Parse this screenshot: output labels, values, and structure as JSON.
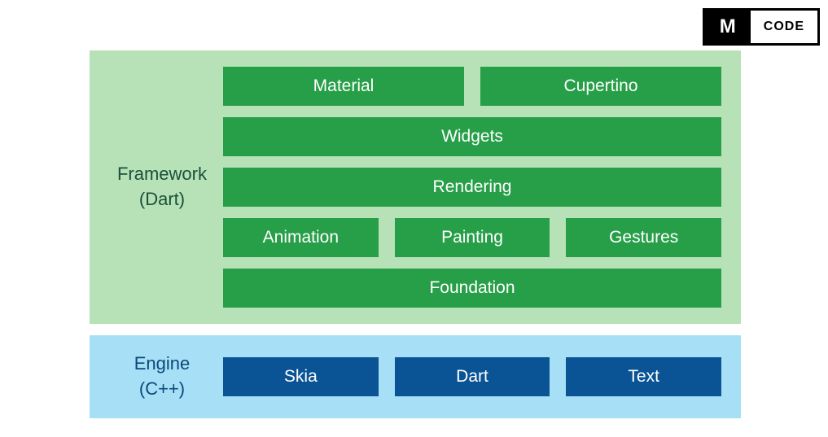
{
  "badge": {
    "letter": "M",
    "text": "CODE"
  },
  "sections": {
    "framework": {
      "label_line1": "Framework",
      "label_line2": "(Dart)",
      "rows": [
        {
          "blocks": [
            "Material",
            "Cupertino"
          ]
        },
        {
          "blocks": [
            "Widgets"
          ]
        },
        {
          "blocks": [
            "Rendering"
          ]
        },
        {
          "blocks": [
            "Animation",
            "Painting",
            "Gestures"
          ]
        },
        {
          "blocks": [
            "Foundation"
          ]
        }
      ]
    },
    "engine": {
      "label_line1": "Engine",
      "label_line2": "(C++)",
      "rows": [
        {
          "blocks": [
            "Skia",
            "Dart",
            "Text"
          ]
        }
      ]
    }
  }
}
